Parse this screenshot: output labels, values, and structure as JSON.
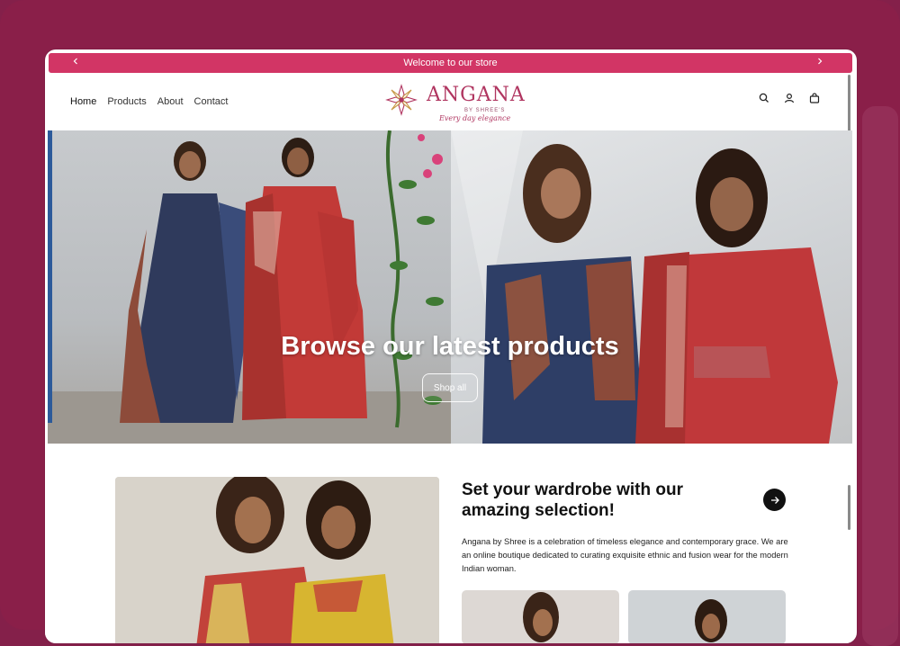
{
  "announcement": {
    "text": "Welcome to our store",
    "prev_icon": "chevron-left-icon",
    "next_icon": "chevron-right-icon"
  },
  "nav": {
    "items": [
      {
        "label": "Home"
      },
      {
        "label": "Products"
      },
      {
        "label": "About"
      },
      {
        "label": "Contact"
      }
    ]
  },
  "logo": {
    "name": "ANGANA",
    "subtitle": "BY SHREE'S",
    "tagline": "Every day elegance",
    "brand_color": "#b03560"
  },
  "header_icons": [
    "search-icon",
    "account-icon",
    "cart-icon"
  ],
  "hero": {
    "title": "Browse our latest products",
    "button_label": "Shop all"
  },
  "feature": {
    "title": "Set your wardrobe with our amazing selection!",
    "body": "Angana by Shree is a celebration of timeless elegance and contemporary grace. We are an online boutique dedicated to curating exquisite ethnic and fusion wear for the modern Indian woman."
  },
  "colors": {
    "page_background": "#8a1f49",
    "announcement_bar": "#d23565",
    "text_dark": "#111111"
  }
}
